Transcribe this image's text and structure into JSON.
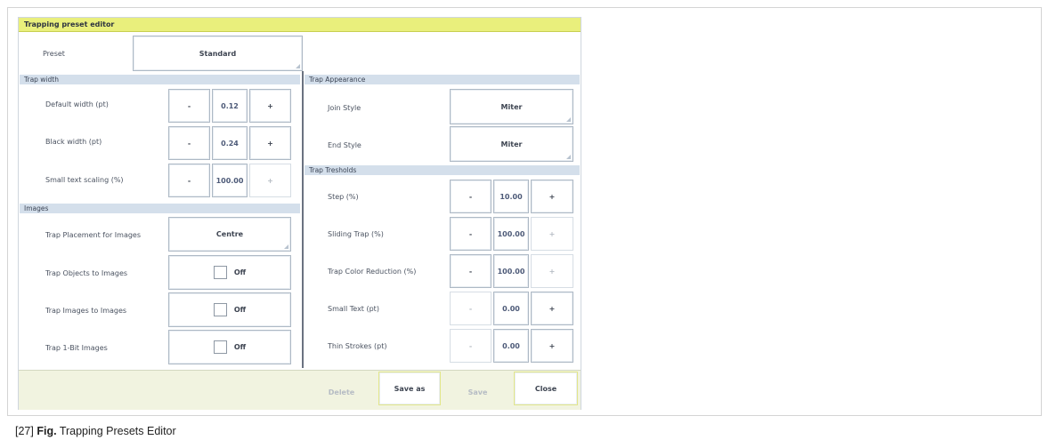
{
  "window": {
    "title": "Trapping preset editor"
  },
  "preset": {
    "label": "Preset",
    "value": "Standard"
  },
  "trap_width": {
    "header": "Trap width",
    "rows": [
      {
        "label": "Default width (pt)",
        "minus": "-",
        "value": "0.12",
        "plus": "+",
        "plus_enabled": true
      },
      {
        "label": "Black width (pt)",
        "minus": "-",
        "value": "0.24",
        "plus": "+",
        "plus_enabled": true
      },
      {
        "label": "Small text scaling (%)",
        "minus": "-",
        "value": "100.00",
        "plus": "+",
        "plus_enabled": false
      }
    ]
  },
  "images": {
    "header": "Images",
    "placement": {
      "label": "Trap Placement for Images",
      "value": "Centre"
    },
    "toggles": [
      {
        "label": "Trap Objects to Images",
        "state": "Off"
      },
      {
        "label": "Trap Images to Images",
        "state": "Off"
      },
      {
        "label": "Trap 1-Bit Images",
        "state": "Off"
      }
    ]
  },
  "appearance": {
    "header": "Trap Appearance",
    "join": {
      "label": "Join Style",
      "value": "Miter"
    },
    "end": {
      "label": "End Style",
      "value": "Miter"
    }
  },
  "thresholds": {
    "header": "Trap Tresholds",
    "rows": [
      {
        "label": "Step (%)",
        "minus": "-",
        "value": "10.00",
        "plus": "+",
        "minus_enabled": true,
        "plus_enabled": true
      },
      {
        "label": "Sliding Trap (%)",
        "minus": "-",
        "value": "100.00",
        "plus": "+",
        "minus_enabled": true,
        "plus_enabled": false
      },
      {
        "label": "Trap Color Reduction (%)",
        "minus": "-",
        "value": "100.00",
        "plus": "+",
        "minus_enabled": true,
        "plus_enabled": false
      },
      {
        "label": "Small Text (pt)",
        "minus": "-",
        "value": "0.00",
        "plus": "+",
        "minus_enabled": false,
        "plus_enabled": true
      },
      {
        "label": "Thin Strokes (pt)",
        "minus": "-",
        "value": "0.00",
        "plus": "+",
        "minus_enabled": false,
        "plus_enabled": true
      }
    ]
  },
  "footer": {
    "delete": "Delete",
    "save_as": "Save as",
    "save": "Save",
    "close": "Close"
  },
  "caption": {
    "number": "[27]",
    "fig": "Fig.",
    "text": "Trapping Presets Editor"
  },
  "colors": {
    "titlebar": "#e9ef7c",
    "section": "#d4dfeb",
    "footer": "#f1f3e0"
  }
}
